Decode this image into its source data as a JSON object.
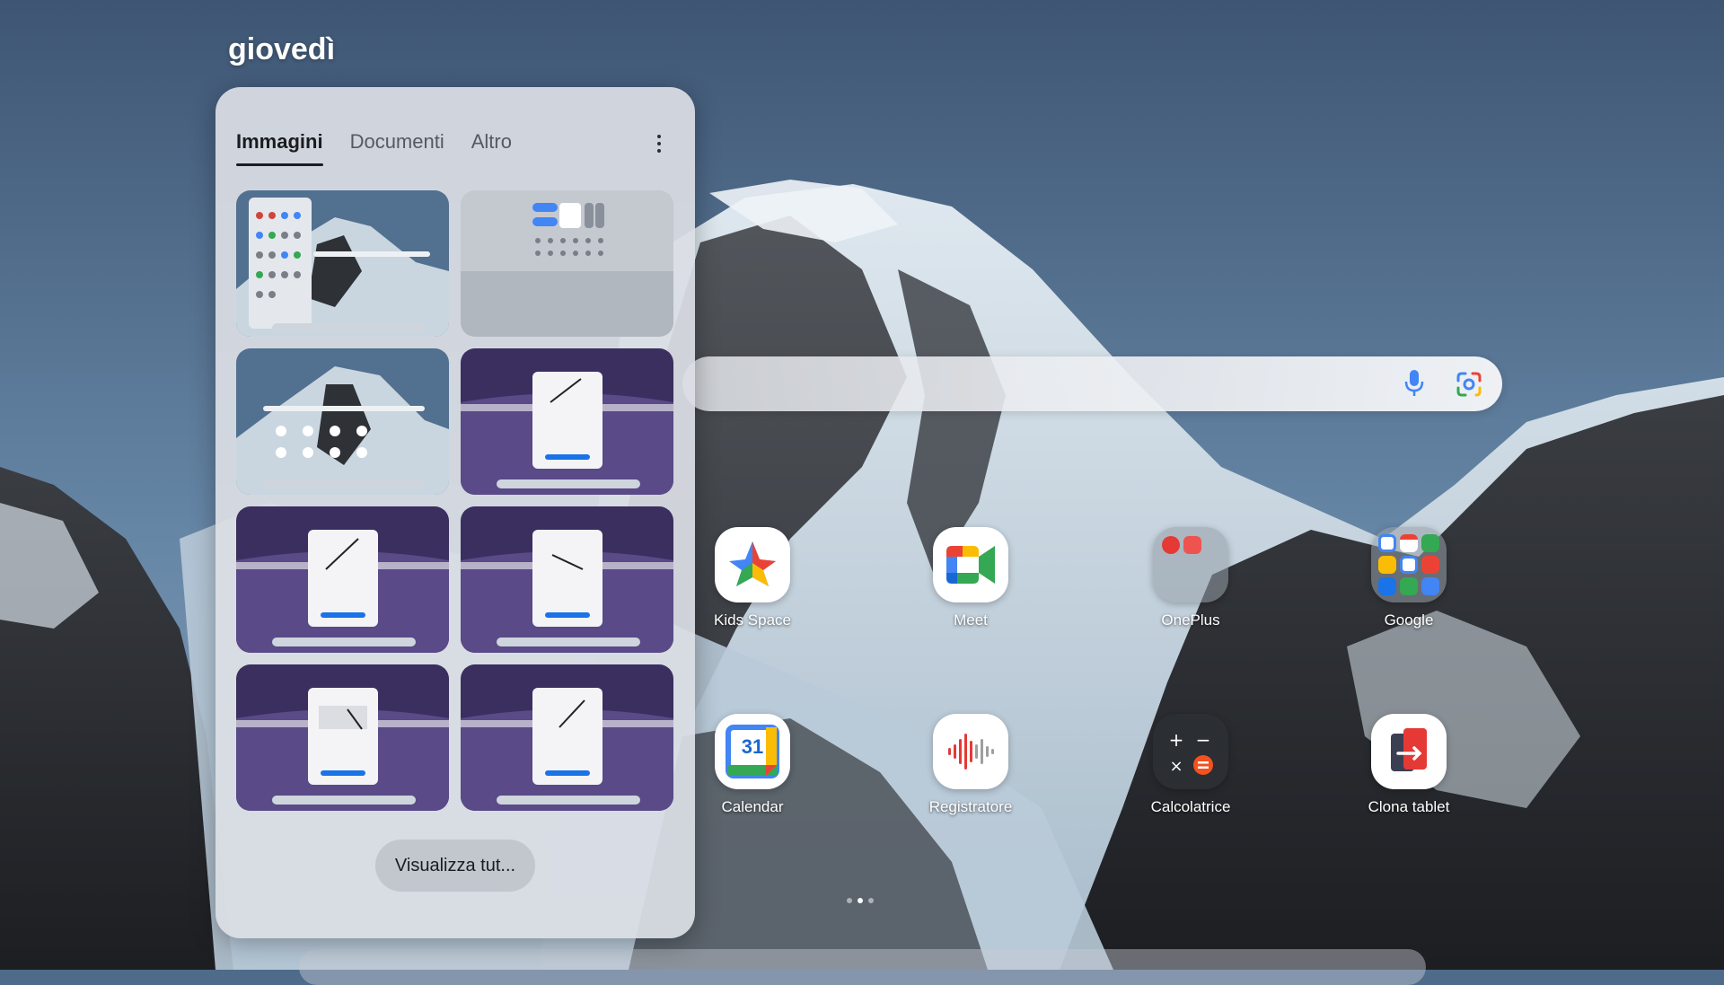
{
  "home": {
    "day": "giovedì",
    "apps": [
      {
        "label": "Kids Space"
      },
      {
        "label": "Meet"
      },
      {
        "label": "OnePlus"
      },
      {
        "label": "Google"
      },
      {
        "label": "Calendar"
      },
      {
        "label": "Registratore"
      },
      {
        "label": "Calcolatrice"
      },
      {
        "label": "Clona tablet"
      }
    ],
    "calendar_day": "31"
  },
  "panel": {
    "tabs": [
      {
        "label": "Immagini",
        "active": true
      },
      {
        "label": "Documenti",
        "active": false
      },
      {
        "label": "Altro",
        "active": false
      }
    ],
    "view_all_label": "Visualizza tut..."
  },
  "colors": {
    "sky": "#4e6b8a",
    "panel_bg": "#dadee4",
    "thumb_purple": "#3a2f5e"
  },
  "icons": [
    "mic-icon",
    "google-lens-icon",
    "more-vert-icon"
  ]
}
